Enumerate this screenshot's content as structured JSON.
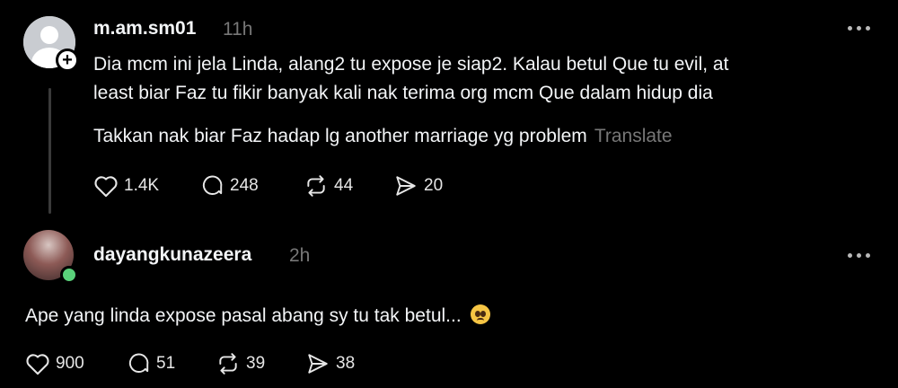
{
  "posts": [
    {
      "username": "m.am.sm01",
      "time": "11h",
      "paragraphs": [
        "Dia mcm ini jela Linda, alang2 tu expose je siap2. Kalau betul Que tu evil, at",
        "least biar Faz tu fikir banyak kali nak terima org mcm Que dalam hidup dia",
        "Takkan nak biar Faz hadap lg another marriage yg problem"
      ],
      "translate_label": "Translate",
      "stats": {
        "likes": "1.4K",
        "replies": "248",
        "reposts": "44",
        "shares": "20"
      },
      "avatar_icon": "default-user-avatar",
      "badge_icon": "plus-icon"
    },
    {
      "username": "dayangkunazeera",
      "time": "2h",
      "text": "Ape yang linda expose pasal abang sy tu tak betul...",
      "emoji_icon": "pleading-face-emoji",
      "stats": {
        "likes": "900",
        "replies": "51",
        "reposts": "39",
        "shares": "38"
      },
      "avatar_icon": "profile-photo",
      "status_color": "#5ad17a"
    }
  ],
  "colors": {
    "background": "#000000",
    "text": "#f3f5f7",
    "muted": "#777777"
  }
}
